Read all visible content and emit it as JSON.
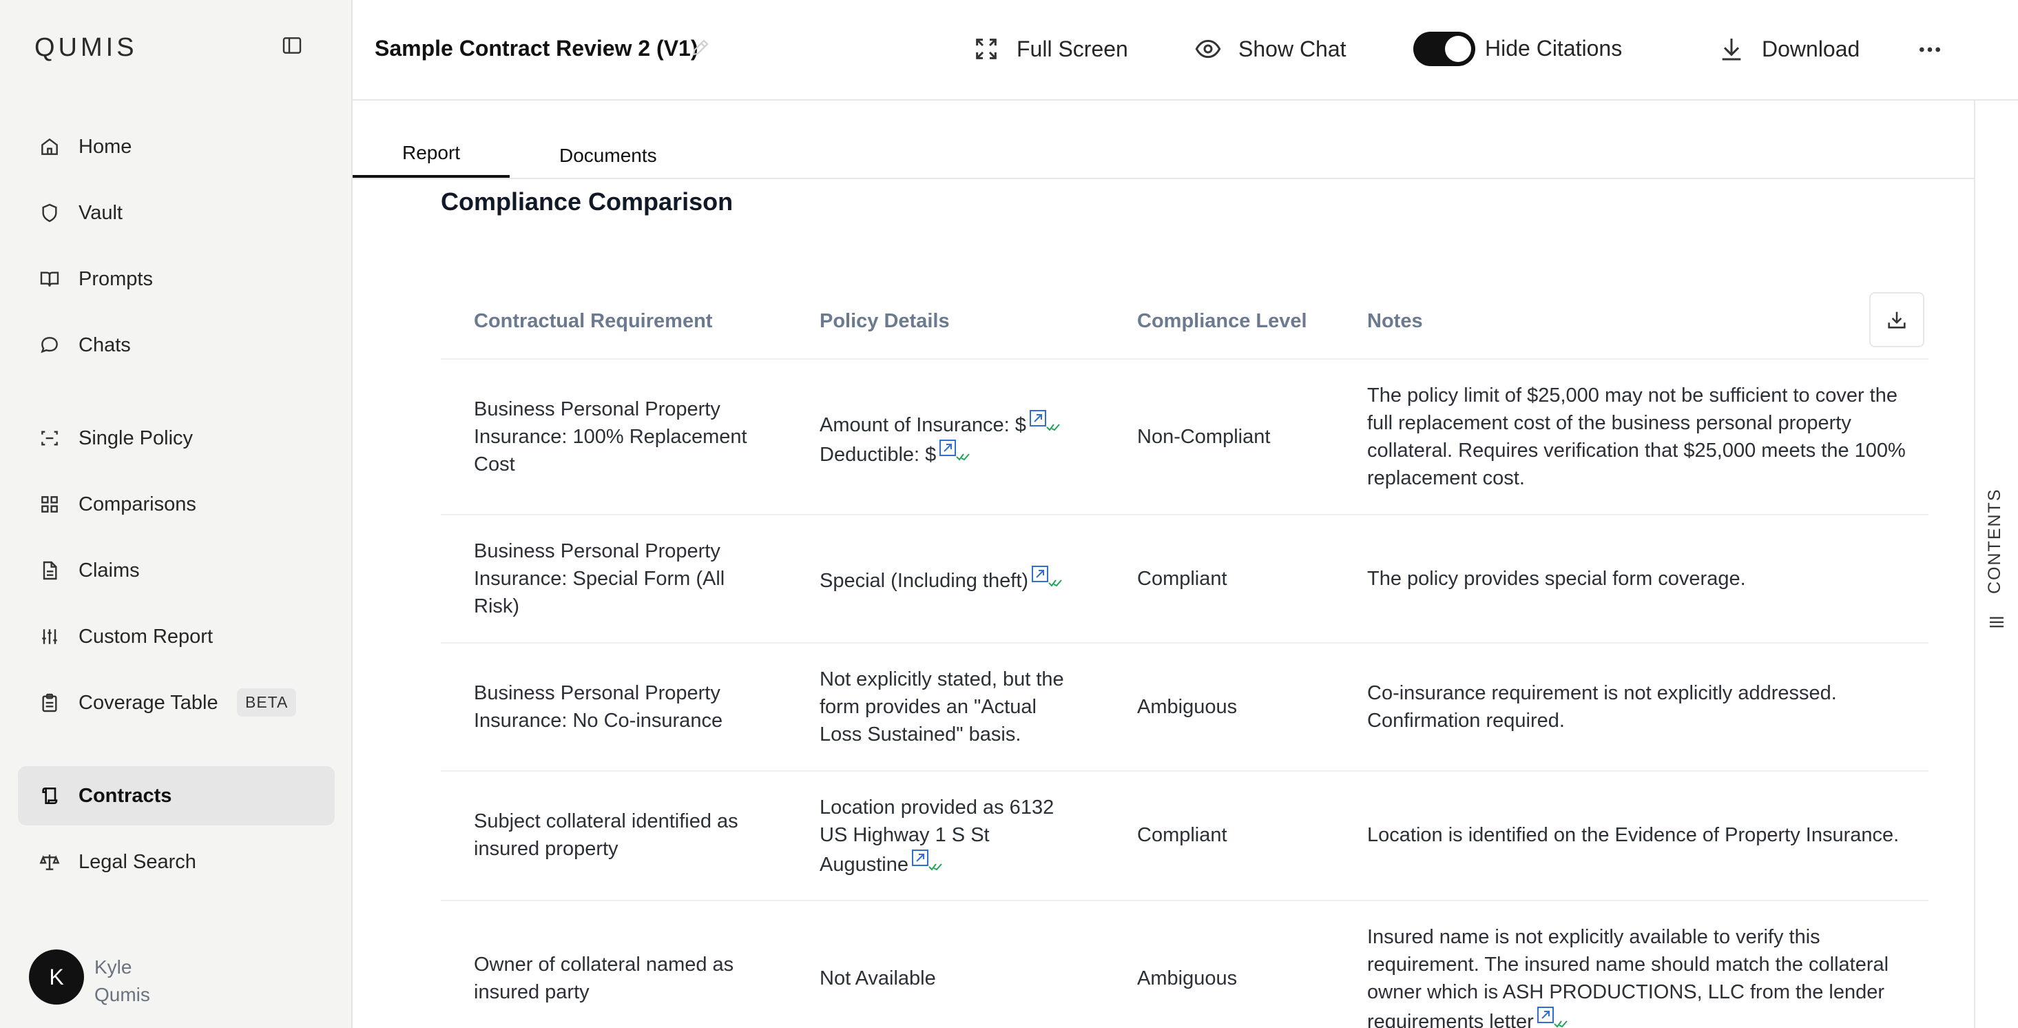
{
  "app": {
    "logo": "QUMIS"
  },
  "sidebar": {
    "items": [
      {
        "label": "Home",
        "icon": "home-icon"
      },
      {
        "label": "Vault",
        "icon": "shield-icon"
      },
      {
        "label": "Prompts",
        "icon": "book-icon"
      },
      {
        "label": "Chats",
        "icon": "chat-icon"
      },
      {
        "label": "Single Policy",
        "icon": "scan-icon"
      },
      {
        "label": "Comparisons",
        "icon": "grid-icon"
      },
      {
        "label": "Claims",
        "icon": "file-icon"
      },
      {
        "label": "Custom Report",
        "icon": "sliders-icon"
      },
      {
        "label": "Coverage Table",
        "icon": "clipboard-icon",
        "badge": "BETA"
      },
      {
        "label": "Contracts",
        "icon": "scroll-icon",
        "active": true
      },
      {
        "label": "Legal Search",
        "icon": "scale-icon"
      }
    ],
    "user": {
      "initial": "K",
      "first": "Kyle",
      "last": "Qumis"
    }
  },
  "header": {
    "title": "Sample Contract Review 2 (V1)",
    "full_screen": "Full Screen",
    "show_chat": "Show Chat",
    "hide_citations": "Hide Citations",
    "download": "Download"
  },
  "tabs": [
    {
      "label": "Report",
      "active": true
    },
    {
      "label": "Documents"
    }
  ],
  "report": {
    "section_title": "Compliance Comparison",
    "columns": [
      "Contractual Requirement",
      "Policy Details",
      "Compliance Level",
      "Notes"
    ],
    "rows": [
      {
        "requirement": [
          "Business Personal Property",
          "Insurance: 100% Replacement",
          "Cost"
        ],
        "policy": [
          "Amount of Insurance: $",
          "Deductible: $"
        ],
        "level": "Non-Compliant",
        "notes": [
          "The policy limit of $25,000 may not be sufficient to cover the",
          "full replacement cost of the business personal property",
          "collateral. Requires verification that $25,000 meets the 100%",
          "replacement cost."
        ]
      },
      {
        "requirement": [
          "Business Personal Property",
          "Insurance: Special Form (All",
          "Risk)"
        ],
        "policy": [
          "Special (Including theft)"
        ],
        "level": "Compliant",
        "notes": [
          "The policy provides special form coverage."
        ]
      },
      {
        "requirement": [
          "Business Personal Property",
          "Insurance: No Co-insurance"
        ],
        "policy": [
          "Not explicitly stated, but the",
          "form provides an \"Actual",
          "Loss Sustained\" basis."
        ],
        "level": "Ambiguous",
        "notes": [
          "Co-insurance requirement is not explicitly addressed.",
          "Confirmation required."
        ]
      },
      {
        "requirement": [
          "Subject collateral identified as",
          "insured property"
        ],
        "policy": [
          "Location provided as 6132",
          "US Highway 1 S St",
          "Augustine"
        ],
        "level": "Compliant",
        "notes": [
          "Location is identified on the Evidence of Property Insurance."
        ]
      },
      {
        "requirement": [
          "Owner of collateral named as",
          "insured party"
        ],
        "policy": [
          "Not Available"
        ],
        "level": "Ambiguous",
        "notes": [
          "Insured name is not explicitly available to verify this",
          "requirement. The insured name should match the collateral",
          "owner which is ASH PRODUCTIONS, LLC from the lender",
          "requirements letter"
        ]
      }
    ]
  },
  "rail": {
    "label": "CONTENTS"
  },
  "colors": {
    "accent": "#111111",
    "citation_blue": "#2f6fd1",
    "citation_green": "#22a35a"
  }
}
